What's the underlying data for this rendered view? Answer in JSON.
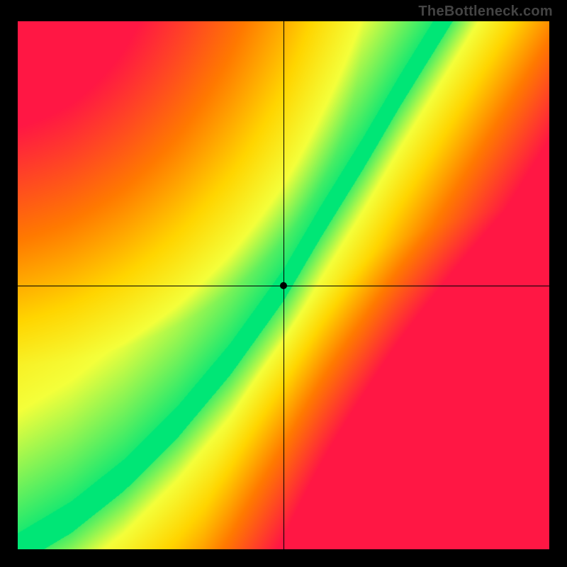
{
  "attribution": "TheBottleneck.com",
  "chart_data": {
    "type": "heatmap",
    "title": "",
    "xlabel": "",
    "ylabel": "",
    "xlim": [
      0,
      1
    ],
    "ylim": [
      0,
      1
    ],
    "crosshair": {
      "x": 0.5,
      "y": 0.5
    },
    "marker": {
      "x": 0.5,
      "y": 0.5
    },
    "colorscale": [
      {
        "value": 0.0,
        "color": "#ff1744"
      },
      {
        "value": 0.35,
        "color": "#ff7a00"
      },
      {
        "value": 0.6,
        "color": "#ffd500"
      },
      {
        "value": 0.8,
        "color": "#f4ff3a"
      },
      {
        "value": 1.0,
        "color": "#00e676"
      }
    ],
    "description": "2D bottleneck heatmap. Green ridge (optimal) follows a diagonal S-curve from bottom-left to top-right, steeper than y=x in the upper half. Bottom-right and top-left regions trend toward red (severe bottleneck). Upper-right off-ridge region is yellow-orange.",
    "ridge_points": [
      {
        "x": 0.0,
        "y": 0.0
      },
      {
        "x": 0.1,
        "y": 0.06
      },
      {
        "x": 0.2,
        "y": 0.14
      },
      {
        "x": 0.3,
        "y": 0.24
      },
      {
        "x": 0.4,
        "y": 0.36
      },
      {
        "x": 0.5,
        "y": 0.5
      },
      {
        "x": 0.57,
        "y": 0.62
      },
      {
        "x": 0.65,
        "y": 0.75
      },
      {
        "x": 0.72,
        "y": 0.87
      },
      {
        "x": 0.8,
        "y": 1.0
      }
    ],
    "ridge_width_fraction": 0.06
  }
}
